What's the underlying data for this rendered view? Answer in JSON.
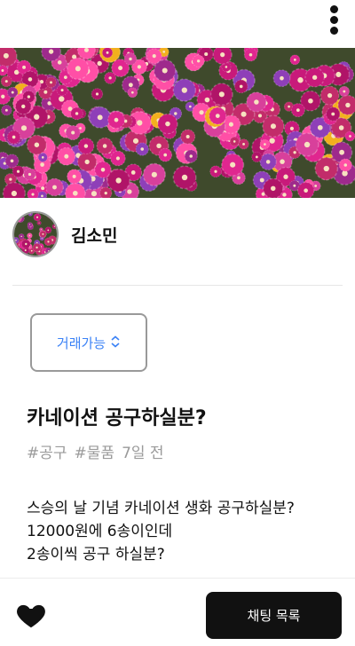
{
  "header": {
    "menu_icon": "more-vertical-icon"
  },
  "hero": {
    "image_subject": "magenta-flower-field-photo"
  },
  "profile": {
    "name": "김소민",
    "avatar": "flower-avatar"
  },
  "status": {
    "label": "거래가능",
    "icon": "chevron-up-down-icon"
  },
  "post": {
    "title": "카네이션 공구하실분?",
    "tags": [
      "#공구",
      "#물품"
    ],
    "time": "7일 전",
    "body": [
      "스승의 날 기념 카네이션 생화 공구하실분?",
      "12000원에 6송이인데",
      "2송이씩 공구 하실분?"
    ]
  },
  "footer": {
    "like_icon": "heart-icon",
    "chat_label": "채팅 목록"
  },
  "colors": {
    "accent": "#3b82f6",
    "button_bg": "#111111",
    "flower_magenta": "#c81a7a"
  }
}
